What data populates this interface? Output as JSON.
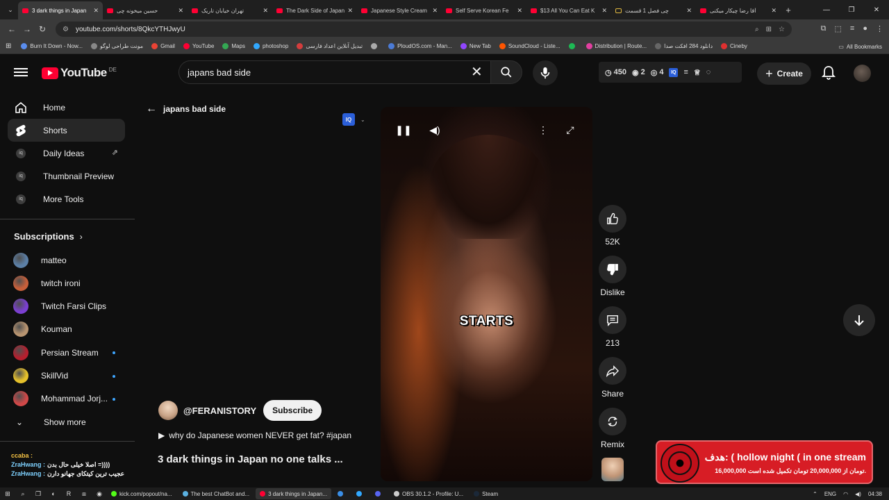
{
  "browser": {
    "tabs": [
      {
        "label": "3 dark things in Japan",
        "active": true
      },
      {
        "label": "حسین میخونه چی"
      },
      {
        "label": "تهران خیابان تاریک"
      },
      {
        "label": "The Dark Side of Japan"
      },
      {
        "label": "Japanese Style Cream"
      },
      {
        "label": "Self Serve Korean Fe"
      },
      {
        "label": "$13 All You Can Eat K"
      },
      {
        "label": "چی فصل 1 قسمت",
        "folder": true
      },
      {
        "label": "آقا رضا چیکار میکنی"
      }
    ],
    "url": "youtube.com/shorts/8QkcYTHJwyU",
    "bookmarks": [
      {
        "label": "Burn It Down - Now...",
        "color": "#5a8dee"
      },
      {
        "label": "مونت طراحی لوگو",
        "color": "#888888"
      },
      {
        "label": "Gmail",
        "color": "#ea4335"
      },
      {
        "label": "YouTube",
        "color": "#ff0033"
      },
      {
        "label": "Maps",
        "color": "#34a853"
      },
      {
        "label": "photoshop",
        "color": "#31a8ff"
      },
      {
        "label": "تبدیل آنلاین اعداد فارسی",
        "color": "#d43d3d"
      },
      {
        "label": "",
        "color": "#aaaaaa"
      },
      {
        "label": "PloudOS.com - Man...",
        "color": "#4b7bd6"
      },
      {
        "label": "New Tab",
        "color": "#9146ff"
      },
      {
        "label": "SoundCloud - Liste...",
        "color": "#ff5500"
      },
      {
        "label": "",
        "color": "#1db954"
      },
      {
        "label": "Distribution | Route...",
        "color": "#e23fa0"
      },
      {
        "label": "دانلود 284 افکت صدا",
        "color": "#666666"
      },
      {
        "label": "Cineby",
        "color": "#e03030"
      }
    ],
    "all_bookmarks_label": "All Bookmarks"
  },
  "header": {
    "logo_text": "YouTube",
    "country_code": "DE",
    "search_query": "japans bad side",
    "stats": {
      "views": "450",
      "eye_count": "2",
      "watch_count": "4"
    },
    "create_label": "Create"
  },
  "sidebar": {
    "items": [
      {
        "label": "Home"
      },
      {
        "label": "Shorts"
      },
      {
        "label": "Daily Ideas"
      },
      {
        "label": "Thumbnail Preview"
      },
      {
        "label": "More Tools"
      }
    ],
    "subscriptions_title": "Subscriptions",
    "subscriptions": [
      {
        "label": "matteo",
        "color": "#5b7fa6",
        "dot": false
      },
      {
        "label": "twitch ironi",
        "color": "#c75f3a",
        "dot": false
      },
      {
        "label": "Twitch Farsi Clips",
        "color": "#7b3fd1",
        "dot": false
      },
      {
        "label": "Kouman",
        "color": "#b89470",
        "dot": false
      },
      {
        "label": "Persian Stream",
        "color": "#b51f2e",
        "dot": true
      },
      {
        "label": "SkillVid",
        "color": "#e6c12b",
        "dot": true
      },
      {
        "label": "Mohammad Jorj...",
        "color": "#d04848",
        "dot": true
      }
    ],
    "show_more_label": "Show more"
  },
  "chat": [
    {
      "name": "ccaba :",
      "message": "",
      "blue": false
    },
    {
      "name": "ZraHwang :",
      "message": "اصلا خیلی حال بدن =))))",
      "blue": true
    },
    {
      "name": "ZraHwang :",
      "message": "عجیب ترین کیتکای جهانو دارن",
      "blue": true
    }
  ],
  "main": {
    "back_label": "japans bad side",
    "caption": "STARTS",
    "channel_name": "@FERANISTORY",
    "subscribe_label": "Subscribe",
    "description": "why do Japanese women NEVER get fat? #japan",
    "title": "3 dark things in Japan no one talks ..."
  },
  "actions": {
    "like_count": "52K",
    "dislike_label": "Dislike",
    "comment_count": "213",
    "share_label": "Share",
    "remix_label": "Remix"
  },
  "overlay": {
    "donation_title": "هدف: ( hollow night ( in one stream",
    "donation_progress": "16,000,000 تومان از 20,000,000 تومان تکمیل شده است."
  },
  "taskbar": {
    "apps": [
      {
        "label": "kick.com/popout/na...",
        "color": "#53fc18"
      },
      {
        "label": "The best ChatBot and...",
        "color": "#5ab0e0"
      },
      {
        "label": "3 dark things in Japan...",
        "color": "#ff0033",
        "active": true
      },
      {
        "label": "",
        "color": "#3a8ee6"
      },
      {
        "label": "",
        "color": "#31a8ff"
      },
      {
        "label": "",
        "color": "#5865f2"
      },
      {
        "label": "OBS 30.1.2 - Profile: U...",
        "color": "#cccccc"
      },
      {
        "label": "Steam",
        "color": "#1b2838"
      }
    ],
    "language": "ENG",
    "time": "04:38"
  }
}
